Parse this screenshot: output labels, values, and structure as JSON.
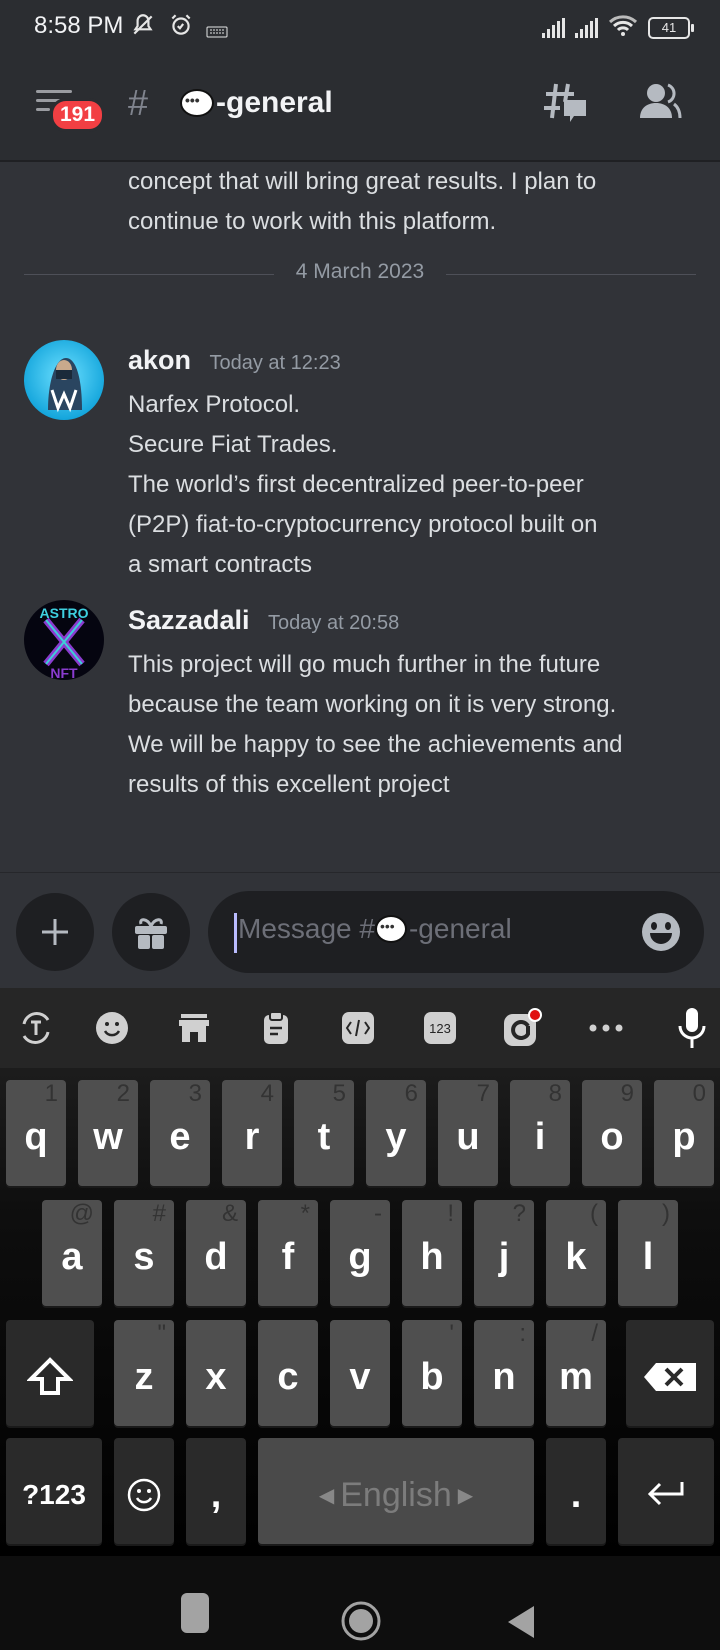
{
  "status_bar": {
    "time": "8:58 PM",
    "icons": [
      "mute-icon",
      "alarm-icon",
      "keyboard-icon"
    ],
    "right_icons": [
      "signal-icon",
      "signal-icon",
      "wifi-icon"
    ],
    "battery": "41"
  },
  "header": {
    "unread_badge": "191",
    "channel_hash": "#",
    "channel_name": "-general",
    "channel_emoji": "speech-bubble",
    "threads_icon": "threads-icon",
    "members_icon": "members-icon"
  },
  "chat": {
    "previous_message_tail": [
      "concept that will bring great results. I plan to",
      "continue to work with this platform."
    ],
    "date_divider": "4 March 2023",
    "messages": [
      {
        "author": "akon",
        "timestamp": "Today at 12:23",
        "lines": [
          "Narfex Protocol.",
          "Secure Fiat Trades.",
          "The world’s first decentralized peer-to-peer",
          "(P2P) fiat-to-cryptocurrency protocol built on",
          "a smart contracts"
        ]
      },
      {
        "author": "Sazzadali",
        "timestamp": "Today at 20:58",
        "lines": [
          "This project will go much further in the future",
          "because the team working on it is very strong.",
          "We will be happy to see the achievements and",
          "results of this excellent project"
        ]
      }
    ]
  },
  "composer": {
    "placeholder_prefix": "Message #",
    "placeholder_suffix": "-general"
  },
  "keyboard": {
    "toolbar": [
      "translate-icon",
      "sticker-icon",
      "store-icon",
      "clipboard-icon",
      "text-edit-icon",
      "numpad-icon",
      "gif-icon",
      "more-icon",
      "mic-icon"
    ],
    "numpad_label": "123",
    "row1": [
      [
        "q",
        "1"
      ],
      [
        "w",
        "2"
      ],
      [
        "e",
        "3"
      ],
      [
        "r",
        "4"
      ],
      [
        "t",
        "5"
      ],
      [
        "y",
        "6"
      ],
      [
        "u",
        "7"
      ],
      [
        "i",
        "8"
      ],
      [
        "o",
        "9"
      ],
      [
        "p",
        "0"
      ]
    ],
    "row2": [
      [
        "a",
        "@"
      ],
      [
        "s",
        "#"
      ],
      [
        "d",
        "&"
      ],
      [
        "f",
        "*"
      ],
      [
        "g",
        "-"
      ],
      [
        "h",
        "!"
      ],
      [
        "j",
        "?"
      ],
      [
        "k",
        "("
      ],
      [
        "l",
        ")"
      ]
    ],
    "row3": [
      [
        "z",
        "\""
      ],
      [
        "x",
        ""
      ],
      [
        "c",
        ""
      ],
      [
        "v",
        ""
      ],
      [
        "b",
        "'"
      ],
      [
        "n",
        ":"
      ],
      [
        "m",
        "/"
      ]
    ],
    "symbols_label": "?123",
    "comma": ",",
    "space_label": "English",
    "period": "."
  }
}
